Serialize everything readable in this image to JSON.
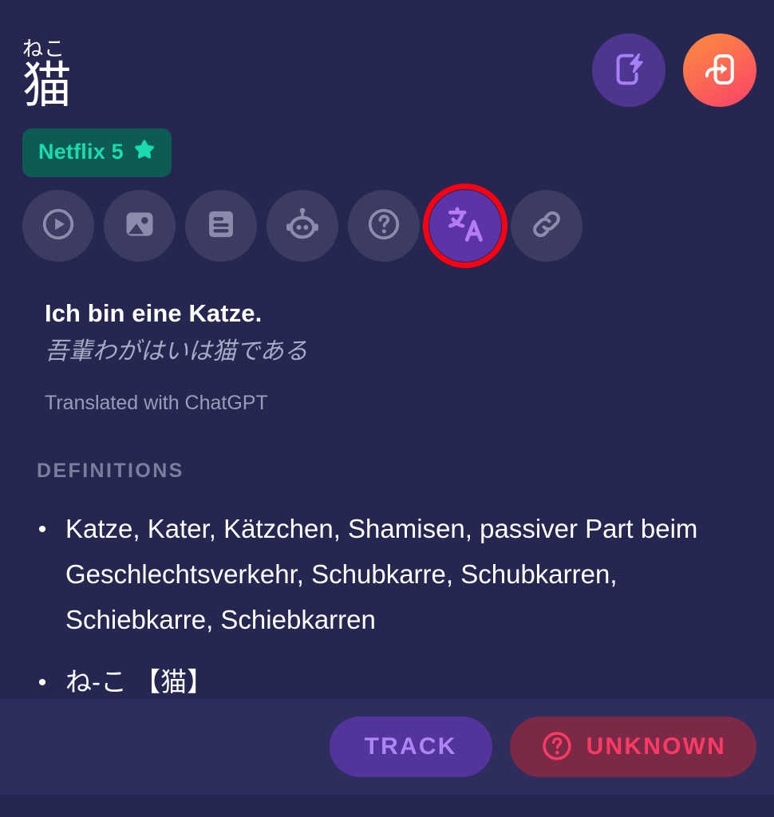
{
  "word": {
    "furigana": "ねこ",
    "headword": "猫"
  },
  "badge": {
    "label": "Netflix 5",
    "icon": "star-icon",
    "background": "#0d5c54",
    "accent": "#18dcae"
  },
  "top_actions": [
    {
      "name": "flashcard-button",
      "icon": "flashcard-lightning-icon",
      "background": "#4d3590",
      "accent": "#a580f5"
    },
    {
      "name": "export-button",
      "icon": "export-arrow-icon",
      "background": "#fb6a52",
      "accent": "#ffffff"
    }
  ],
  "icon_row": [
    {
      "name": "play-icon",
      "label": "Play",
      "active": false
    },
    {
      "name": "image-icon",
      "label": "Images",
      "active": false
    },
    {
      "name": "article-icon",
      "label": "Article",
      "active": false
    },
    {
      "name": "robot-icon",
      "label": "AI",
      "active": false
    },
    {
      "name": "help-icon",
      "label": "Help",
      "active": false
    },
    {
      "name": "translate-icon",
      "label": "Translate",
      "active": true
    },
    {
      "name": "link-icon",
      "label": "Link",
      "active": false
    }
  ],
  "translation": {
    "primary": "Ich bin eine Katze.",
    "original": "吾輩わがはいは猫である",
    "source": "Translated with ChatGPT"
  },
  "definitions": {
    "heading": "DEFINITIONS",
    "items": [
      "Katze, Kater, Kätzchen, Shamisen, passiver Part beim Geschlechtsverkehr, Schubkarre, Schubkarren, Schiebkarre, Schiebkarren",
      "ね-こ 【猫】"
    ]
  },
  "bottom_bar": {
    "track": {
      "label": "TRACK",
      "background": "#53349a",
      "accent": "#ad85f7"
    },
    "unknown": {
      "label": "UNKNOWN",
      "icon": "question-circle-icon",
      "background": "#7c2847",
      "accent": "#fb3b63"
    }
  },
  "theme": {
    "background": "#262750",
    "bottom_bar_background": "#2d2e5d",
    "chip_background": "#3c3c63",
    "chip_active_background": "#5b34a8",
    "highlight_ring": "#fb0013"
  }
}
